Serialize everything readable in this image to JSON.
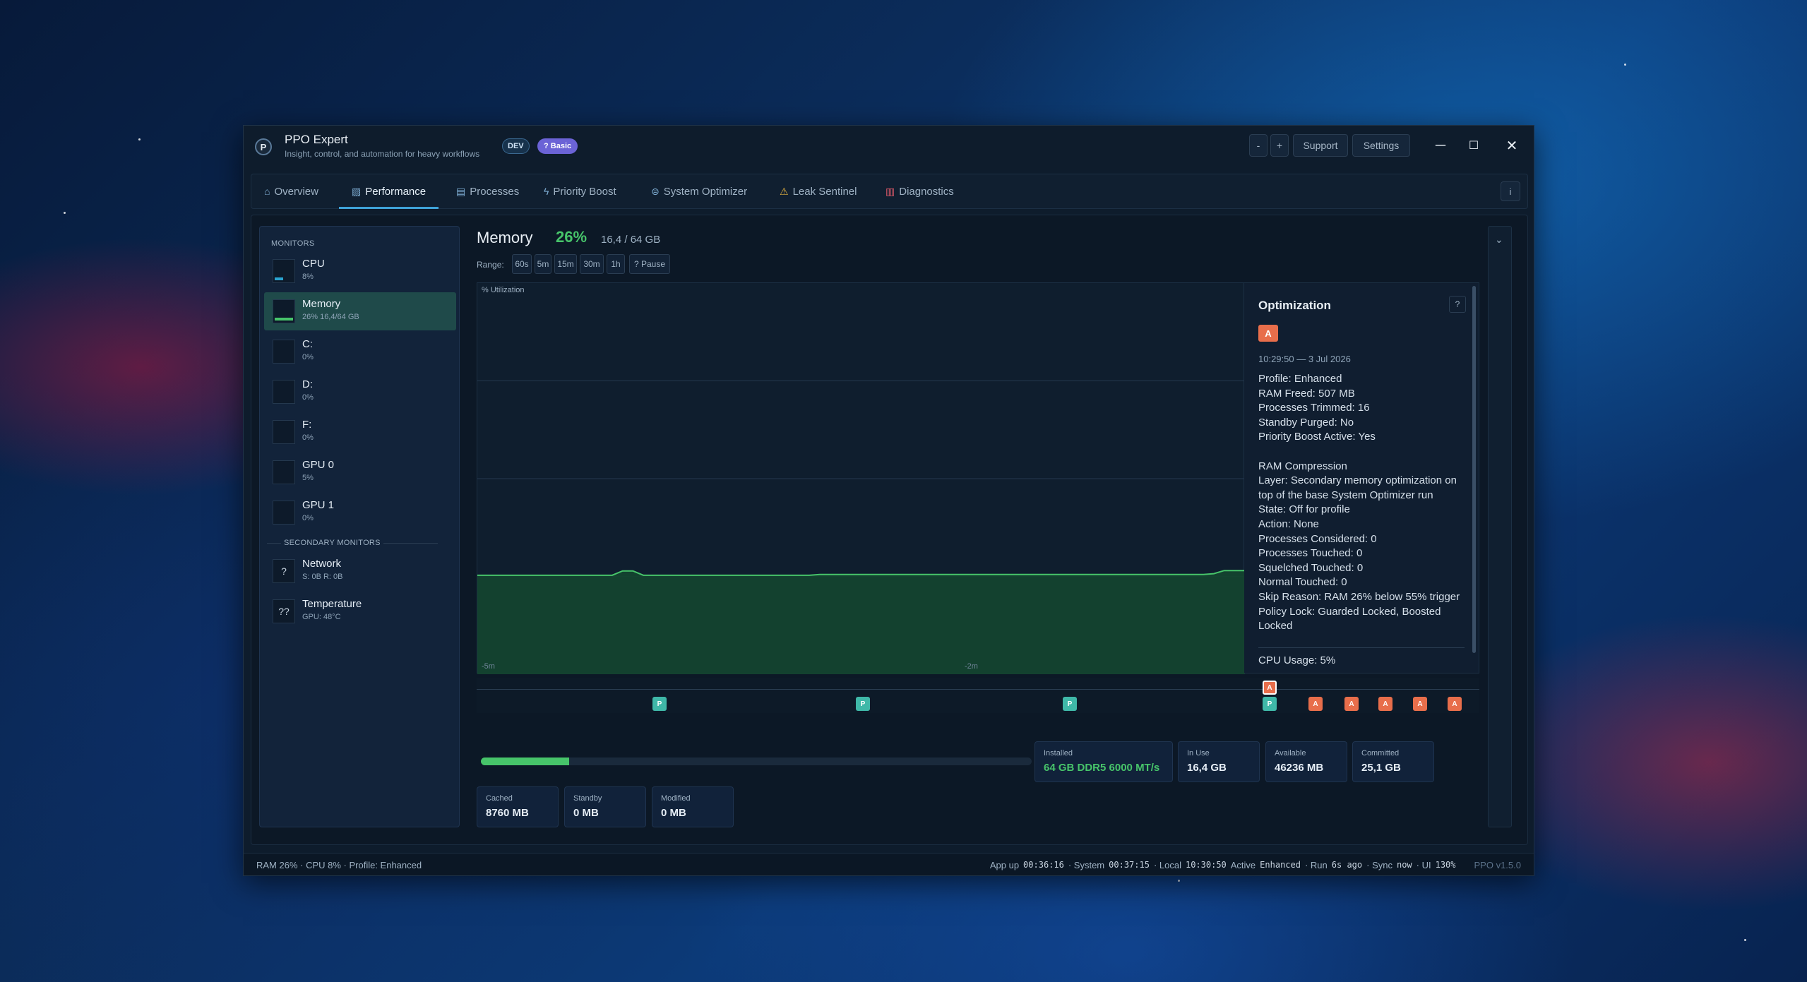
{
  "app": {
    "title": "PPO Expert",
    "subtitle": "Insight, control, and automation for heavy workflows",
    "badge_dev": "DEV",
    "badge_basic": "? Basic"
  },
  "titlebar": {
    "zoom_out": "-",
    "zoom_in": "+",
    "support": "Support",
    "settings": "Settings"
  },
  "tabs": [
    {
      "label": "Overview",
      "icon": "home-icon"
    },
    {
      "label": "Performance",
      "icon": "chart-icon"
    },
    {
      "label": "Processes",
      "icon": "file-icon"
    },
    {
      "label": "Priority Boost",
      "icon": "bolt-icon"
    },
    {
      "label": "System Optimizer",
      "icon": "gamepad-icon"
    },
    {
      "label": "Leak Sentinel",
      "icon": "warning-icon"
    },
    {
      "label": "Diagnostics",
      "icon": "diagnostics-icon"
    }
  ],
  "tab_info": "i",
  "sidebar": {
    "monitors_heading": "MONITORS",
    "items": [
      {
        "name": "CPU",
        "sub": "8%"
      },
      {
        "name": "Memory",
        "sub": "26%  16,4/64 GB"
      },
      {
        "name": "C:",
        "sub": "0%"
      },
      {
        "name": "D:",
        "sub": "0%"
      },
      {
        "name": "F:",
        "sub": "0%"
      },
      {
        "name": "GPU 0",
        "sub": "5%"
      },
      {
        "name": "GPU 1",
        "sub": "0%"
      }
    ],
    "secondary_heading": "SECONDARY MONITORS",
    "secondary": [
      {
        "name": "Network",
        "sub": "S: 0B  R: 0B",
        "icon": "?"
      },
      {
        "name": "Temperature",
        "sub": "GPU: 48°C",
        "icon": "??"
      }
    ]
  },
  "main": {
    "title": "Memory",
    "percent": "26%",
    "usage": "16,4 / 64 GB",
    "range_label": "Range:",
    "ranges": [
      "60s",
      "5m",
      "15m",
      "30m",
      "1h",
      "? Pause"
    ]
  },
  "chart_data": {
    "type": "area",
    "ylabel": "% Utilization",
    "x_ticks": [
      "-5m",
      "-2m"
    ],
    "ylim": [
      0,
      100
    ],
    "series": [
      {
        "values": [
          25.3,
          25.3,
          25.3,
          25.3,
          25.3,
          25.3,
          25.3,
          25.3,
          25.3,
          25.3,
          25.3,
          25.3,
          25.3,
          25.3,
          26.4,
          26.4,
          25.3,
          25.3,
          25.3,
          25.3,
          25.3,
          25.3,
          25.3,
          25.3,
          25.3,
          25.3,
          25.3,
          25.3,
          25.3,
          25.3,
          25.3,
          25.3,
          25.3,
          25.5,
          25.5,
          25.5,
          25.5,
          25.5,
          25.5,
          25.5,
          25.5,
          25.5,
          25.5,
          25.5,
          25.5,
          25.5,
          25.5,
          25.5,
          25.5,
          25.5,
          25.5,
          25.5,
          25.5,
          25.5,
          25.5,
          25.5,
          25.5,
          25.5,
          25.5,
          25.5,
          25.5,
          25.5,
          25.5,
          25.5,
          25.5,
          25.5,
          25.5,
          25.5,
          25.5,
          25.5,
          25.5,
          25.7,
          26.5,
          26.5,
          26.5
        ]
      }
    ],
    "grid": true
  },
  "optimization": {
    "title": "Optimization",
    "help": "?",
    "badge": "A",
    "time": "10:29:50 — 3 Jul 2026",
    "lines": [
      "Profile: Enhanced",
      "RAM Freed: 507 MB",
      "Processes Trimmed: 16",
      "Standby Purged: No",
      "Priority Boost Active: Yes",
      "",
      "RAM Compression",
      "Layer: Secondary memory optimization on top of the base System Optimizer run",
      "State: Off for profile",
      "Action: None",
      "Processes Considered: 0",
      "Processes Touched: 0",
      "Squelched Touched: 0",
      "Normal Touched: 0",
      "Skip Reason: RAM 26% below 55% trigger",
      "Policy Lock: Guarded Locked, Boosted Locked"
    ],
    "cpu": "CPU Usage: 5%"
  },
  "timeline": {
    "p_label": "P",
    "a_label": "A"
  },
  "memory_bar": {
    "fill_fraction": 0.16
  },
  "stats": {
    "installed": {
      "k": "Installed",
      "v": "64 GB DDR5 6000 MT/s"
    },
    "inuse": {
      "k": "In Use",
      "v": "16,4 GB"
    },
    "available": {
      "k": "Available",
      "v": "46236 MB"
    },
    "committed": {
      "k": "Committed",
      "v": "25,1 GB"
    },
    "cached": {
      "k": "Cached",
      "v": "8760 MB"
    },
    "standby": {
      "k": "Standby",
      "v": "0 MB"
    },
    "modified": {
      "k": "Modified",
      "v": "0 MB"
    }
  },
  "status": {
    "left": "RAM 26%  ·  CPU 8%  ·  Profile: Enhanced",
    "appup_label": "App up",
    "appup": "00:36:16",
    "system_label": "· System",
    "system": "00:37:15",
    "local_label": "· Local",
    "local": "10:30:50",
    "active_label": "Active",
    "active": "Enhanced",
    "run_label": "· Run",
    "run": "6s ago",
    "sync_label": "· Sync",
    "sync": "now",
    "ui_label": "· UI",
    "ui": "130%",
    "version": "PPO v1.5.0"
  },
  "colors": {
    "accent": "#3fa3d8",
    "green": "#47c46a",
    "orange": "#e86e4b",
    "teal": "#3fb8a8"
  }
}
